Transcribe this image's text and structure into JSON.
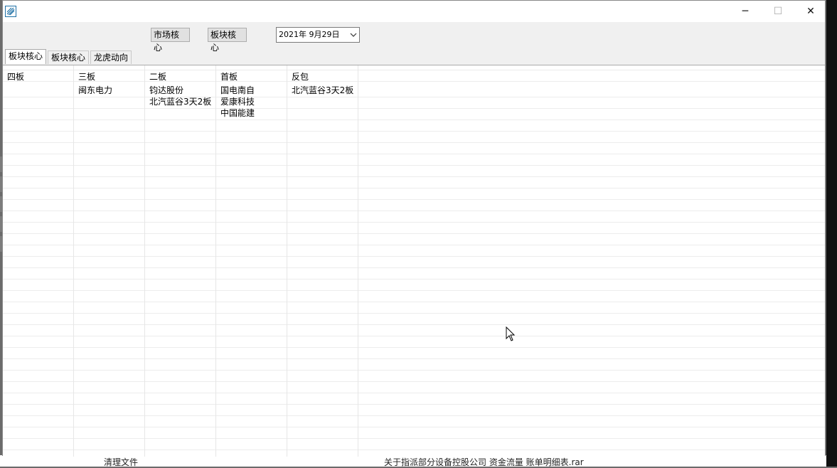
{
  "window": {
    "controls": {
      "minimize": "─",
      "maximize": "☐",
      "close": "✕"
    }
  },
  "toolbar": {
    "market_core_label": "市场核心",
    "sector_core_label": "板块核心",
    "date_value": "2021年 9月29日"
  },
  "tabs": [
    {
      "label": "板块核心",
      "active": true
    },
    {
      "label": "板块核心",
      "active": false
    },
    {
      "label": "龙虎动向",
      "active": false
    }
  ],
  "board": {
    "columns": [
      {
        "header": "四板",
        "items": []
      },
      {
        "header": "三板",
        "items": [
          "闽东电力"
        ]
      },
      {
        "header": "二板",
        "items": [
          "钧达股份",
          "北汽蓝谷3天2板"
        ]
      },
      {
        "header": "首板",
        "items": [
          "国电南自",
          "爱康科技",
          "中国能建"
        ]
      },
      {
        "header": "反包",
        "items": [
          "北汽蓝谷3天2板"
        ]
      }
    ]
  },
  "background": {
    "file_a": "清理文件",
    "file_b": "关于指派部分设备控股公司 资金流量 账单明细表.rar"
  },
  "icons": {
    "app": "app-icon",
    "cursor": "mouse-pointer-icon",
    "dropdown": "chevron-down-icon"
  }
}
